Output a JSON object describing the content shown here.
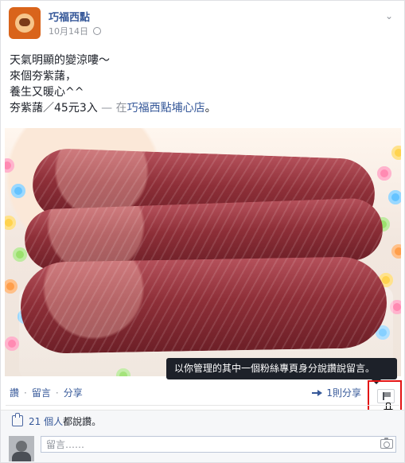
{
  "post": {
    "page_name": "巧福西點",
    "date": "10月14日",
    "privacy_icon": "globe-icon",
    "text_lines": [
      "天氣明顯的變涼嘍～",
      "來個夯紫藷，",
      "養生又暖心^^"
    ],
    "text_line_4_prefix": "夯紫藷／45元3入",
    "location_separator": " — 在",
    "location_name": "巧福西點埔心店",
    "location_suffix": "。",
    "photo_alt": "三條夯紫藷"
  },
  "tooltip": {
    "text": "以你管理的其中一個粉絲專頁身分說讚說留言。"
  },
  "actions": {
    "like": "讚",
    "comment": "留言",
    "share": "分享",
    "dot": "·",
    "share_count": "1則分享"
  },
  "reactions": {
    "count": "21 個人",
    "suffix": "都說讚。"
  },
  "comment": {
    "placeholder": "留言……"
  },
  "colors": {
    "link": "#365899",
    "text": "#1d2129",
    "muted": "#90949c",
    "highlight_box": "#e31414",
    "tooltip_bg": "#1d2129"
  }
}
